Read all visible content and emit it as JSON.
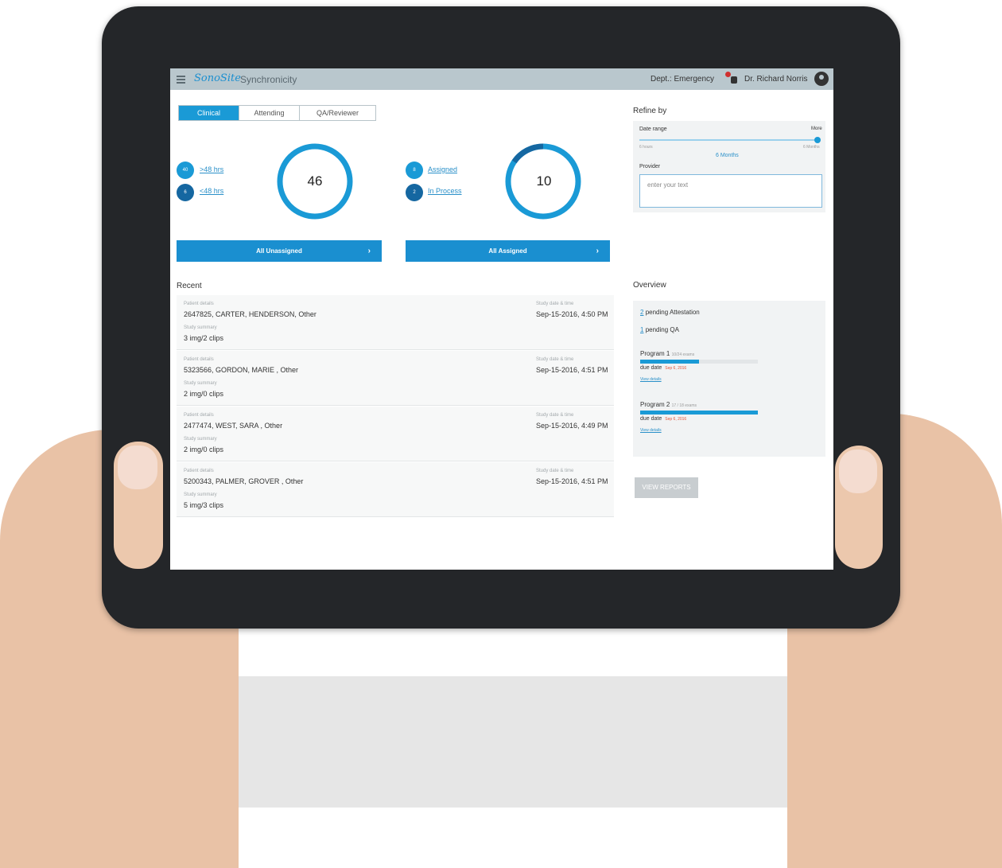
{
  "header": {
    "brand": "SonoSite",
    "brand_suffix": "Synchronicity",
    "department": "Dept.: Emergency",
    "user_name": "Dr. Richard Norris"
  },
  "tabs": [
    {
      "label": "Clinical",
      "active": true
    },
    {
      "label": "Attending",
      "active": false
    },
    {
      "label": "QA/Reviewer",
      "active": false
    }
  ],
  "unassigned": {
    "total": "46",
    "pills": [
      {
        "count": "40",
        "label": ">48 hrs"
      },
      {
        "count": "6",
        "label": "<48 hrs"
      }
    ],
    "button_label": "All Unassigned",
    "chevron": "›"
  },
  "assigned": {
    "total": "10",
    "pills": [
      {
        "count": "8",
        "label": "Assigned"
      },
      {
        "count": "2",
        "label": "In Process"
      }
    ],
    "button_label": "All Assigned",
    "chevron": "›"
  },
  "recent": {
    "title": "Recent",
    "patient_caption": "Patient details",
    "summary_caption": "Study summary",
    "date_caption": "Study date & time",
    "rows": [
      {
        "patient": "2647825, CARTER, HENDERSON, Other",
        "summary": "3 img/2 clips",
        "datetime": "Sep-15-2016, 4:50 PM"
      },
      {
        "patient": "5323566, GORDON, MARIE , Other",
        "summary": "2 img/0 clips",
        "datetime": "Sep-15-2016, 4:51 PM"
      },
      {
        "patient": "2477474, WEST, SARA , Other",
        "summary": "2 img/0 clips",
        "datetime": "Sep-15-2016, 4:49 PM"
      },
      {
        "patient": "5200343, PALMER, GROVER , Other",
        "summary": "5 img/3 clips",
        "datetime": "Sep-15-2016, 4:51 PM"
      }
    ]
  },
  "refine": {
    "title": "Refine by",
    "date_range_label": "Date range",
    "date_range_max": "More",
    "min_label": "6 hours",
    "max_label": "6 Months",
    "selected_range": "6 Months",
    "provider_label": "Provider",
    "provider_placeholder": "enter your text"
  },
  "overview": {
    "title": "Overview",
    "pending_attestation_count": "2",
    "pending_attestation_label": "pending Attestation",
    "pending_qa_count": "1",
    "pending_qa_label": "pending QA",
    "programs": [
      {
        "name": "Program 1",
        "detail": "10/24 exams",
        "progress": 0.5,
        "progress_label": "50%",
        "due_label": "due date",
        "due_value": "Sep 6, 2016",
        "link": "View details"
      },
      {
        "name": "Program 2",
        "detail": "17 / 18 exams",
        "progress": 1.0,
        "progress_label": "100%",
        "due_label": "due date",
        "due_value": "Sep 6, 2016",
        "link": "View details"
      }
    ]
  },
  "view_reports_label": "VIEW REPORTS",
  "colors": {
    "accent": "#1a9ad6",
    "button": "#1a8fd0",
    "pill_dark": "#1567a1",
    "topbar": "#b9c7cd"
  }
}
